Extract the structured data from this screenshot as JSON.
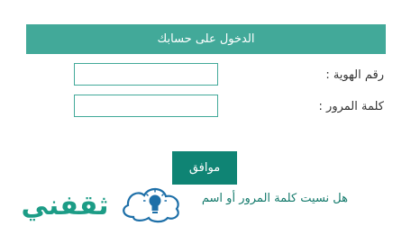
{
  "header": {
    "title": "الدخول على حسابك"
  },
  "form": {
    "id_label": "رقم الهوية :",
    "id_value": "",
    "password_label": "كلمة المرور :",
    "password_value": "",
    "submit_label": "موافق",
    "forgot_link": "هل نسيت كلمة المرور أو اسم"
  },
  "logo": {
    "text": "ثقفني",
    "icon": "lightbulb-icon"
  },
  "colors": {
    "header_bg": "#42a999",
    "button_bg": "#0f8474",
    "input_border": "#42a999",
    "link": "#147a6c",
    "logo_green": "#1c9c86",
    "logo_blue": "#1d6fa8"
  }
}
